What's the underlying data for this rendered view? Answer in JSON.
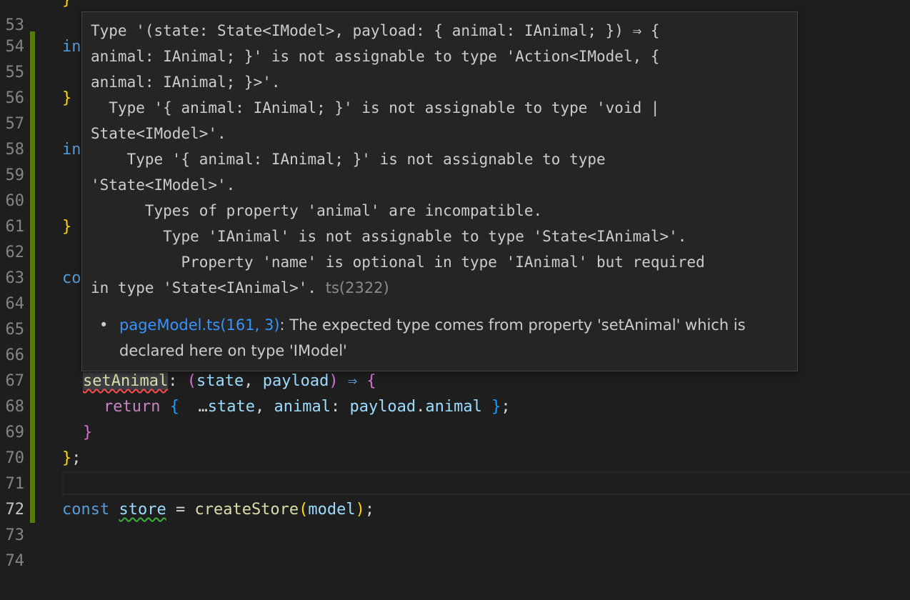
{
  "gutter": {
    "line_numbers": [
      "54",
      "55",
      "56",
      "57",
      "58",
      "59",
      "60",
      "61",
      "62",
      "63",
      "64",
      "65",
      "66",
      "67",
      "68",
      "69",
      "70",
      "71",
      "72",
      "73",
      "74"
    ],
    "partial_top": "53"
  },
  "code": {
    "l155": "in",
    "l157": "}",
    "l159": "in",
    "l162": "}",
    "l164": "co",
    "l168": {
      "prop": "setAnimal",
      "colon": ": ",
      "p1": "(",
      "state": "state",
      "comma": ", ",
      "payload": "payload",
      "p2": ")",
      "arrow": " ⇒ ",
      "brace": "{"
    },
    "l169": {
      "ret": "return",
      "open": " { ",
      "spread": " …",
      "state": "state",
      "comma": ", ",
      "animal": "animal",
      "colon": ": ",
      "payload": "payload",
      "dot": ".",
      "animal2": "animal",
      "close": " }",
      "semi": ";"
    },
    "l170": "}",
    "l171": {
      "brace": "}",
      "semi": ";"
    },
    "l173": {
      "const": "const",
      "store": "store",
      "eq": " = ",
      "fn": "createStore",
      "p1": "(",
      "model": "model",
      "p2": ")",
      "semi": ";"
    }
  },
  "hover": {
    "message": "Type '(state: State<IModel>, payload: { animal: IAnimal; }) ⇒ {\nanimal: IAnimal; }' is not assignable to type 'Action<IModel, {\nanimal: IAnimal; }>'.\n  Type '{ animal: IAnimal; }' is not assignable to type 'void |\nState<IModel>'.\n    Type '{ animal: IAnimal; }' is not assignable to type\n'State<IModel>'.\n      Types of property 'animal' are incompatible.\n        Type 'IAnimal' is not assignable to type 'State<IAnimal>'.\n          Property 'name' is optional in type 'IAnimal' but required\nin type 'State<IAnimal>'. ",
    "error_code": "ts(2322)",
    "related_bullet": "•",
    "related_link": "pageModel.ts(161, 3)",
    "related_text": ": The expected type comes from property 'setAnimal' which is declared here on type 'IModel'"
  },
  "colors": {
    "background": "#1e1e1e",
    "hover_background": "#252526",
    "gutter_modified": "#587c0c",
    "link": "#3794ff",
    "error_squiggle": "#f14c4c",
    "warning_squiggle": "#3ea83e"
  }
}
